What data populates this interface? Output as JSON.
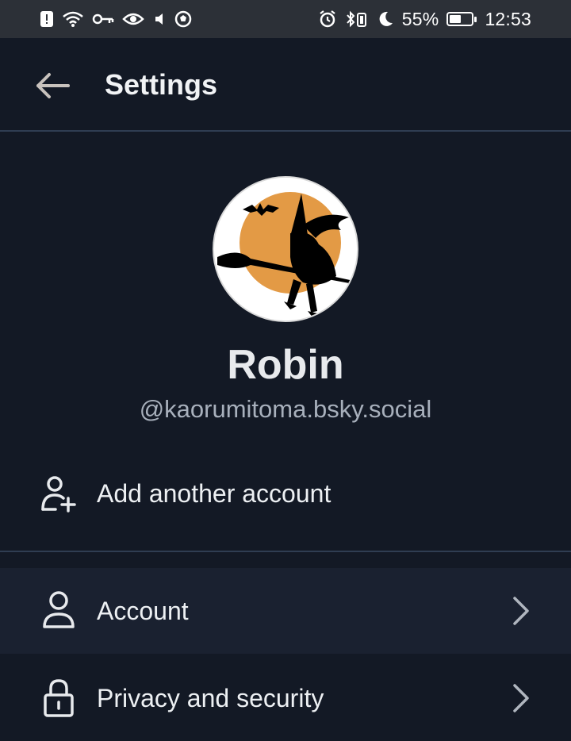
{
  "status_bar": {
    "left_icons": [
      "alert-icon",
      "wifi-icon",
      "key-icon",
      "eye-icon",
      "volume-icon",
      "soccer-ball-icon"
    ],
    "right_icons": [
      "alarm-icon",
      "bluetooth-vibrate-icon",
      "moon-icon",
      "battery-icon"
    ],
    "battery_percent": "55%",
    "battery_level": 0.55,
    "time": "12:53"
  },
  "header": {
    "title": "Settings",
    "back_icon": "arrow-left-icon"
  },
  "profile": {
    "avatar_icon": "witch-silhouette-avatar",
    "name": "Robin",
    "handle": "@kaorumitoma.bsky.social",
    "add_account_label": "Add another account",
    "add_account_icon": "user-plus-icon"
  },
  "menu": {
    "items": [
      {
        "label": "Account",
        "icon": "user-icon"
      },
      {
        "label": "Privacy and security",
        "icon": "lock-icon"
      }
    ],
    "chevron_icon": "chevron-right-icon"
  },
  "colors": {
    "background": "#131925",
    "status_bar": "#2c3037",
    "divider": "#2f3d52",
    "highlight_row": "#1a2130",
    "avatar_moon": "#e39a45",
    "text_primary": "#edf0f3",
    "text_secondary": "#a8b0bc"
  }
}
